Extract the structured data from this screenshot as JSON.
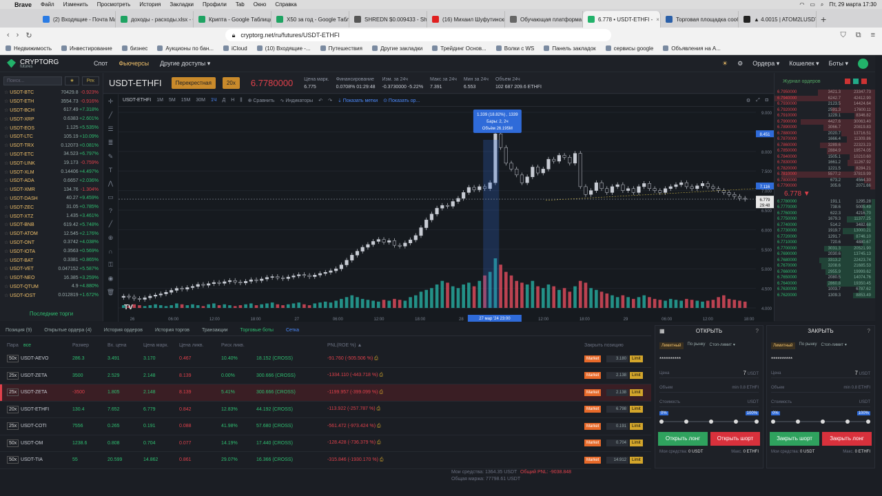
{
  "macos": {
    "app": "Brave",
    "menus": [
      "Файл",
      "Изменить",
      "Просмотреть",
      "История",
      "Закладки",
      "Профили",
      "Tab",
      "Окно",
      "Справка"
    ],
    "datetime": "Пт, 29 марта 17:30"
  },
  "tabs": [
    {
      "label": "(2) Входящие - Почта Mail",
      "color": "#2a7be4"
    },
    {
      "label": "доходы - расходы.xlsx - G",
      "color": "#1ea362"
    },
    {
      "label": "Крипта - Google Таблицы",
      "color": "#1ea362"
    },
    {
      "label": "X50 за год - Google Табли",
      "color": "#1ea362"
    },
    {
      "label": "SHREDN $0.009433 - Shre",
      "color": "#555"
    },
    {
      "label": "(16) Михаил Шуфутинский",
      "color": "#e02020"
    },
    {
      "label": "Обучающая платформа A",
      "color": "#666"
    },
    {
      "label": "6.778 • USDT-ETHFI -",
      "color": "#22b26a"
    },
    {
      "label": "Торговая площадка сообщ",
      "color": "#2a5fa8"
    },
    {
      "label": "▲ 4.0015 | ATOM2LUSDT |",
      "color": "#222"
    }
  ],
  "address": {
    "url": "cryptorg.net/ru/futures/USDT-ETHFI"
  },
  "bookmarks": [
    "Недвижимость",
    "Инвестирование",
    "бизнес",
    "Аукционы по бан...",
    "iCloud",
    "(10) Входящие -...",
    "Путешествия",
    "Другие закладки",
    "Трейдинг Основ...",
    "Волки с WS",
    "Панель закладок",
    "сервисы google",
    "Объявления на А..."
  ],
  "nav": {
    "logo": "CRYPTORG",
    "logo_sub": "futures",
    "items": [
      "Спот",
      "Фьючерсы",
      "Другие доступы ▾"
    ],
    "right": [
      "Ордера ▾",
      "Кошелек ▾",
      "Боты ▾"
    ]
  },
  "sidebar": {
    "search_placeholder": "Поиск...",
    "btn": "Рек",
    "footer": "Последние торги",
    "markets": [
      {
        "n": "USDT-BTC",
        "p": "70429.8",
        "c": "-0.923%"
      },
      {
        "n": "USDT-ETH",
        "p": "3554.73",
        "c": "-0.916%"
      },
      {
        "n": "USDT-BCH",
        "p": "617.49",
        "c": "+7.318%"
      },
      {
        "n": "USDT-XRP",
        "p": "0.6383",
        "c": "+2.601%"
      },
      {
        "n": "USDT-EOS",
        "p": "1.125",
        "c": "+5.535%"
      },
      {
        "n": "USDT-LTC",
        "p": "105.19",
        "c": "+10.09%"
      },
      {
        "n": "USDT-TRX",
        "p": "0.12073",
        "c": "+0.081%"
      },
      {
        "n": "USDT-ETC",
        "p": "34.523",
        "c": "+6.797%"
      },
      {
        "n": "USDT-LINK",
        "p": "19.173",
        "c": "-0.759%"
      },
      {
        "n": "USDT-XLM",
        "p": "0.14406",
        "c": "+4.497%"
      },
      {
        "n": "USDT-ADA",
        "p": "0.6657",
        "c": "+2.036%"
      },
      {
        "n": "USDT-XMR",
        "p": "134.76",
        "c": "-1.304%"
      },
      {
        "n": "USDT-DASH",
        "p": "40.27",
        "c": "+9.459%"
      },
      {
        "n": "USDT-ZEC",
        "p": "31.05",
        "c": "+0.785%"
      },
      {
        "n": "USDT-XTZ",
        "p": "1.435",
        "c": "+3.461%"
      },
      {
        "n": "USDT-BNB",
        "p": "619.42",
        "c": "+5.748%"
      },
      {
        "n": "USDT-ATOM",
        "p": "12.545",
        "c": "+2.176%"
      },
      {
        "n": "USDT-ONT",
        "p": "0.3742",
        "c": "+4.038%"
      },
      {
        "n": "USDT-IOTA",
        "p": "0.3563",
        "c": "+0.569%"
      },
      {
        "n": "USDT-BAT",
        "p": "0.3381",
        "c": "+0.865%"
      },
      {
        "n": "USDT-VET",
        "p": "0.047152",
        "c": "+5.587%"
      },
      {
        "n": "USDT-NEO",
        "p": "16.385",
        "c": "+3.259%"
      },
      {
        "n": "USDT-QTUM",
        "p": "4.9",
        "c": "+4.880%"
      },
      {
        "n": "USDT-IOST",
        "p": "0.012819",
        "c": "+1.672%"
      }
    ]
  },
  "ticker": {
    "symbol": "USDT-ETHFI",
    "mode": "Перекрестная",
    "leverage": "20x",
    "last": "6.7780000",
    "stats": [
      {
        "k": "Цена марк.",
        "v": "6.775"
      },
      {
        "k": "Финансирование",
        "v": "0.0708%  01:29:48"
      },
      {
        "k": "Изм. за 24ч",
        "v": "-0.3730000  -5.22%"
      },
      {
        "k": "Макс за 24ч",
        "v": "7.391"
      },
      {
        "k": "Мин за 24ч",
        "v": "6.553"
      },
      {
        "k": "Объем 24ч",
        "v": "102 687 209.6 ETHFI"
      }
    ]
  },
  "chart_toolbar": {
    "symbol": "USDT-ETHFI",
    "intervals": [
      "1M",
      "5M",
      "15M",
      "30M",
      "1Ч",
      "Д",
      "Н"
    ],
    "selected": "1Ч",
    "compare": "Сравнить",
    "indicators": "Индикаторы",
    "marks": "Показать метки",
    "orders": "Показать ор..."
  },
  "chart_data": {
    "type": "candlestick",
    "y_ticks": [
      "9.000",
      "8.500",
      "8.000",
      "7.500",
      "7.000",
      "6.500",
      "6.000",
      "5.500",
      "5.000",
      "4.500",
      "4.000"
    ],
    "x_ticks": [
      "26",
      "06:00",
      "12:00",
      "18:00",
      "27",
      "06:00",
      "12:00",
      "18:00",
      "28",
      "06:00",
      "12:00",
      "18:00",
      "29",
      "06:00",
      "12:00",
      "18:00"
    ],
    "ylim": [
      4.0,
      9.0
    ],
    "tooltip": [
      "1.339 (18.82%) , 1339",
      "Бары: 2, 2ч",
      "Объём 26.195M"
    ],
    "price_labels": [
      {
        "v": "8.451",
        "kind": "blue"
      },
      {
        "v": "7.116",
        "kind": "blue"
      },
      {
        "v": "6.779",
        "kind": "white"
      },
      {
        "v": "29:48",
        "kind": "white"
      }
    ],
    "x_marker": "27 мар '24  23:00",
    "closes": [
      4.3,
      4.28,
      4.24,
      4.22,
      4.26,
      4.3,
      4.33,
      4.36,
      4.4,
      4.45,
      4.5,
      4.48,
      4.52,
      4.55,
      4.6,
      4.58,
      4.62,
      4.65,
      4.63,
      4.67,
      4.7,
      4.66,
      4.64,
      4.68,
      4.72,
      4.7,
      4.74,
      4.78,
      4.8,
      4.77,
      4.75,
      4.79,
      4.82,
      4.85,
      4.83,
      4.8,
      4.84,
      4.88,
      4.91,
      4.95,
      5.0,
      5.1,
      5.22,
      5.35,
      5.45,
      5.55,
      5.62,
      5.7,
      5.75,
      5.68,
      5.72,
      5.6,
      5.58,
      5.66,
      5.74,
      5.85,
      6.05,
      6.25,
      6.4,
      6.55,
      6.62,
      6.6,
      6.72,
      6.8,
      6.95,
      7.08,
      7.02,
      7.1,
      7.05,
      7.2,
      8.45,
      8.1,
      7.7,
      7.55,
      7.4,
      7.2,
      7.35,
      7.6,
      7.45,
      7.55,
      7.8,
      7.75,
      7.9,
      7.85,
      7.7,
      7.95,
      7.1,
      6.9,
      7.0,
      7.2,
      7.05,
      6.95,
      7.1,
      7.15,
      7.0,
      7.05,
      6.95,
      7.1,
      7.18,
      7.05,
      7.0,
      6.95,
      7.05,
      7.1,
      7.15,
      7.2,
      7.1,
      7.05,
      7.12,
      7.18,
      7.1,
      7.05,
      7.0,
      6.95,
      6.9,
      6.85,
      6.8,
      6.78
    ],
    "volumes": [
      3,
      2,
      4,
      3,
      2,
      3,
      4,
      3,
      2,
      3,
      5,
      4,
      3,
      4,
      3,
      2,
      4,
      5,
      3,
      4,
      3,
      2,
      3,
      4,
      5,
      3,
      4,
      5,
      6,
      4,
      3,
      4,
      5,
      6,
      4,
      3,
      5,
      6,
      7,
      6,
      8,
      10,
      12,
      14,
      12,
      10,
      9,
      8,
      7,
      9,
      8,
      10,
      9,
      8,
      12,
      14,
      18,
      20,
      22,
      26,
      30,
      28,
      24,
      22,
      26,
      28,
      24,
      30,
      36,
      40,
      55,
      48,
      40,
      36,
      30,
      28,
      26,
      30,
      24,
      22,
      26,
      24,
      20,
      22,
      18,
      24,
      30,
      28,
      22,
      20,
      18,
      16,
      14,
      12,
      14,
      12,
      10,
      12,
      14,
      12,
      10,
      9,
      8,
      10,
      9,
      8,
      10,
      9,
      8,
      7,
      8,
      9,
      12,
      14,
      10,
      9,
      8,
      7
    ]
  },
  "orderbook": {
    "title": "Журнал ордеров",
    "mid": "6.778 ▼",
    "asks": [
      [
        "6.7950000",
        "3421.3",
        "23347.73"
      ],
      [
        "6.7940000",
        "6242.7",
        "42412.90"
      ],
      [
        "6.7930000",
        "2123.5",
        "14424.64"
      ],
      [
        "6.7920000",
        "2591.3",
        "17600.11"
      ],
      [
        "6.7910000",
        "1229.1",
        "8346.82"
      ],
      [
        "6.7900000",
        "4427.6",
        "30063.40"
      ],
      [
        "6.7890000",
        "3066.7",
        "20819.83"
      ],
      [
        "6.7880000",
        "2020.7",
        "13716.51"
      ],
      [
        "6.7870000",
        "1666.4",
        "11309.86"
      ],
      [
        "6.7860000",
        "3289.6",
        "22323.23"
      ],
      [
        "6.7850000",
        "2884.9",
        "19574.05"
      ],
      [
        "6.7840000",
        "1505.1",
        "10210.60"
      ],
      [
        "6.7830000",
        "1661.2",
        "11267.92"
      ],
      [
        "6.7820000",
        "1221.5",
        "8284.21"
      ],
      [
        "6.7810000",
        "5577.2",
        "37819.99"
      ],
      [
        "6.7800000",
        "673.2",
        "4564.30"
      ],
      [
        "6.7790000",
        "305.6",
        "2071.66"
      ]
    ],
    "bids": [
      [
        "6.7780000",
        "191.1",
        "1295.28"
      ],
      [
        "6.7770000",
        "738.6",
        "5005.49"
      ],
      [
        "6.7760000",
        "622.3",
        "4216.70"
      ],
      [
        "6.7750000",
        "1679.3",
        "11377.25"
      ],
      [
        "6.7740000",
        "514.2",
        "3482.68"
      ],
      [
        "6.7730000",
        "1919.7",
        "13000.21"
      ],
      [
        "6.7720000",
        "1291.7",
        "8746.10"
      ],
      [
        "6.7710000",
        "720.6",
        "4880.67"
      ],
      [
        "6.7700000",
        "3031.3",
        "20521.90"
      ],
      [
        "6.7690000",
        "2030.6",
        "13745.13"
      ],
      [
        "6.7680000",
        "3313.2",
        "22423.74"
      ],
      [
        "6.7670000",
        "3208.6",
        "21685.53"
      ],
      [
        "6.7660000",
        "2955.9",
        "19999.62"
      ],
      [
        "6.7650000",
        "2080.5",
        "14074.76"
      ],
      [
        "6.7640000",
        "2860.8",
        "19350.45"
      ],
      [
        "6.7630000",
        "1003.7",
        "6787.62"
      ],
      [
        "6.7620000",
        "1309.3",
        "8853.49"
      ]
    ]
  },
  "bottom": {
    "tabs": [
      "Позиция (9)",
      "Открытые ордера (4)",
      "История ордеров",
      "История торгов",
      "Транзакции",
      "Торговые боты",
      "Сетка"
    ],
    "headers": [
      "Пара",
      "Размер",
      "Вх. цена",
      "Цена марк.",
      "Цена ликв.",
      "Риск ликв.",
      "PNL(ROE %) ▲",
      "Закрыть позицию"
    ],
    "all_label": "все",
    "rows": [
      {
        "lev": "50x",
        "pair": "USDT-AEVO",
        "size": "286.3",
        "entry": "3.491",
        "mark": "3.170",
        "liq": "0.467",
        "risk": "10.40%",
        "margin": "18.152 (CROSS)",
        "pnl": "-91.760 (-505.506 %)",
        "lp": "3.180",
        "short": false
      },
      {
        "lev": "25x",
        "pair": "USDT-ZETA",
        "size": "3500",
        "entry": "2.529",
        "mark": "2.148",
        "liq": "8.139",
        "risk": "0.00%",
        "margin": "300.666 (CROSS)",
        "pnl": "-1334.110 (-443.718 %)",
        "lp": "2.138",
        "short": false
      },
      {
        "lev": "25x",
        "pair": "USDT-ZETA",
        "size": "-3500",
        "entry": "1.805",
        "mark": "2.148",
        "liq": "8.139",
        "risk": "5.41%",
        "margin": "300.666 (CROSS)",
        "pnl": "-1199.957 (-399.099 %)",
        "lp": "2.138",
        "short": true
      },
      {
        "lev": "20x",
        "pair": "USDT-ETHFI",
        "size": "130.4",
        "entry": "7.652",
        "mark": "6.779",
        "liq": "0.842",
        "risk": "12.83%",
        "margin": "44.192 (CROSS)",
        "pnl": "-113.922 (-257.787 %)",
        "lp": "6.798",
        "short": false
      },
      {
        "lev": "25x",
        "pair": "USDT-COTI",
        "size": "7556",
        "entry": "0.265",
        "mark": "0.191",
        "liq": "0.088",
        "risk": "41.98%",
        "margin": "57.680 (CROSS)",
        "pnl": "-561.472 (-973.424 %)",
        "lp": "0.191",
        "short": false
      },
      {
        "lev": "50x",
        "pair": "USDT-OM",
        "size": "1238.6",
        "entry": "0.808",
        "mark": "0.704",
        "liq": "0.077",
        "risk": "14.19%",
        "margin": "17.440 (CROSS)",
        "pnl": "-128.428 (-736.379 %)",
        "lp": "0.704",
        "short": false
      },
      {
        "lev": "50x",
        "pair": "USDT-TIA",
        "size": "55",
        "entry": "20.599",
        "mark": "14.862",
        "liq": "0.861",
        "risk": "29.07%",
        "margin": "16.366 (CROSS)",
        "pnl": "-315.846 (-1930.170 %)",
        "lp": "14.912",
        "short": false
      }
    ],
    "market_btn": "Market",
    "limit_btn": "Limit",
    "footer": {
      "funds": "Мои средства: 1364.35 USDT",
      "total_pnl": "Общий PNL: -9038.848",
      "margin": "Общая маржа: 77798.61 USDT"
    }
  },
  "open_panel": {
    "title": "ОТКРЫТЬ",
    "tabs": [
      "Лимитный",
      "По рынку",
      "Стоп-лимит ▾"
    ],
    "account": "**********",
    "price_label": "Цена",
    "price": "7",
    "price_unit": "USDT",
    "amount_label": "Объем",
    "amount_hint": "min 0.8 ETHFI",
    "cost_label": "Стоимость",
    "cost_unit": "USDT",
    "pct_left": "0%",
    "pct_right": "100%",
    "btn_long": "Открыть лонг",
    "btn_short": "Открыть шорт",
    "funds_label": "Мои средства:",
    "funds": "0 USDT",
    "max_label": "Макс.",
    "max": "0 ETHFI"
  },
  "close_panel": {
    "title": "ЗАКРЫТЬ",
    "tabs": [
      "Лимитный",
      "По рынку",
      "Стоп-лимит ▾"
    ],
    "account": "**********",
    "price_label": "Цена",
    "price": "7",
    "price_unit": "USDT",
    "amount_label": "Объем",
    "amount_hint": "min 0.8 ETHFI",
    "cost_label": "Стоимость",
    "cost_unit": "USDT",
    "pct_left": "0%",
    "pct_right": "100%",
    "btn_short": "Закрыть шорт",
    "btn_long": "Закрыть лонг",
    "funds_label": "Мои средства:",
    "funds": "0 USDT",
    "max_label": "Макс.",
    "max": "0 ETHFI"
  }
}
